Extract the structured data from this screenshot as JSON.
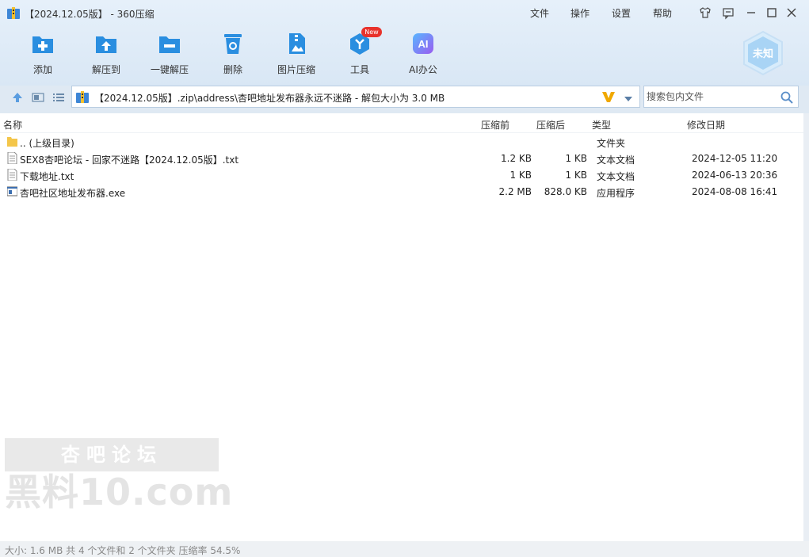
{
  "window": {
    "title": "【2024.12.05版】 - 360压缩",
    "menu": [
      "文件",
      "操作",
      "设置",
      "帮助"
    ]
  },
  "toolbar": {
    "items": [
      {
        "label": "添加",
        "icon": "add-icon"
      },
      {
        "label": "解压到",
        "icon": "extract-to-icon"
      },
      {
        "label": "一键解压",
        "icon": "one-click-extract-icon"
      },
      {
        "label": "删除",
        "icon": "delete-icon"
      },
      {
        "label": "图片压缩",
        "icon": "image-compress-icon"
      },
      {
        "label": "工具",
        "icon": "tools-icon"
      },
      {
        "label": "AI办公",
        "icon": "ai-office-icon"
      }
    ],
    "new_badge": "New",
    "ai_icon_text": "AI",
    "account_badge": "未知"
  },
  "address": {
    "path": "【2024.12.05版】.zip\\address\\杏吧地址发布器永远不迷路 - 解包大小为 3.0 MB"
  },
  "search": {
    "placeholder": "搜索包内文件"
  },
  "list": {
    "columns": [
      "名称",
      "压缩前",
      "压缩后",
      "类型",
      "修改日期"
    ],
    "rows": [
      {
        "icon": "folder-icon",
        "name": ".. (上级目录)",
        "before": "",
        "after": "",
        "type": "文件夹",
        "date": ""
      },
      {
        "icon": "text-file-icon",
        "name": "SEX8杏吧论坛 - 回家不迷路【2024.12.05版】.txt",
        "before": "1.2 KB",
        "after": "1 KB",
        "type": "文本文档",
        "date": "2024-12-05 11:20"
      },
      {
        "icon": "text-file-icon",
        "name": "下载地址.txt",
        "before": "1 KB",
        "after": "1 KB",
        "type": "文本文档",
        "date": "2024-06-13 20:36"
      },
      {
        "icon": "exe-file-icon",
        "name": "杏吧社区地址发布器.exe",
        "before": "2.2 MB",
        "after": "828.0 KB",
        "type": "应用程序",
        "date": "2024-08-08 16:41"
      }
    ]
  },
  "watermark": {
    "top_text": "杏吧论坛",
    "bottom_text": "黑料10.com"
  },
  "status": {
    "text": "大小: 1.6 MB 共 4 个文件和 2 个文件夹 压缩率 54.5%"
  },
  "colors": {
    "accent": "#2a8ee0",
    "toolbar_bg": "#dfe9f3",
    "new_badge": "#e8322c",
    "v_icon": "#f0a800"
  }
}
